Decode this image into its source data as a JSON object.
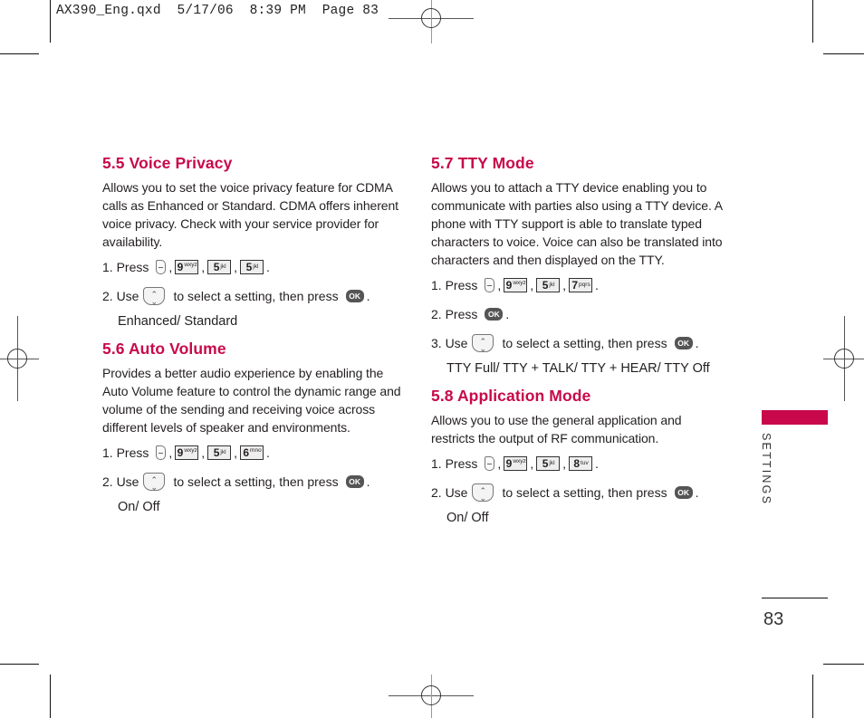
{
  "slug": "AX390_Eng.qxd  5/17/06  8:39 PM  Page 83",
  "sections": [
    {
      "title": "5.5 Voice Privacy",
      "body": "Allows you to set the voice privacy feature for CDMA calls as Enhanced or Standard. CDMA offers inherent voice privacy. Check with your service provider for availability.",
      "step1": {
        "prefix": "1. Press",
        "keys": [
          {
            "num": "9",
            "letters": "wxyz"
          },
          {
            "num": "5",
            "letters": "jkl"
          },
          {
            "num": "5",
            "letters": "jkl"
          }
        ]
      },
      "step2": {
        "prefix": "2. Use",
        "middle": "to select a setting, then press",
        "ok": "OK"
      },
      "options": "Enhanced/ Standard"
    },
    {
      "title": "5.6 Auto Volume",
      "body": "Provides a better audio experience by enabling the Auto Volume feature to control the dynamic range and volume of the sending and receiving voice across different levels of speaker and environments.",
      "step1": {
        "prefix": "1. Press",
        "keys": [
          {
            "num": "9",
            "letters": "wxyz"
          },
          {
            "num": "5",
            "letters": "jkl"
          },
          {
            "num": "6",
            "letters": "mno"
          }
        ]
      },
      "step2": {
        "prefix": "2. Use",
        "middle": "to select a setting, then press",
        "ok": "OK"
      },
      "options": "On/ Off"
    },
    {
      "title": "5.7 TTY Mode",
      "body": "Allows you to attach a TTY device enabling you to communicate with parties also using a TTY device. A phone with TTY support is able to translate typed characters to voice. Voice can also be translated into characters and then displayed on the TTY.",
      "step1": {
        "prefix": "1. Press",
        "keys": [
          {
            "num": "9",
            "letters": "wxyz"
          },
          {
            "num": "5",
            "letters": "jkl"
          },
          {
            "num": "7",
            "letters": "pqrs"
          }
        ]
      },
      "step2": {
        "prefix": "2. Press",
        "ok": "OK"
      },
      "step3": {
        "prefix": "3. Use",
        "middle": "to select a setting, then press",
        "ok": "OK"
      },
      "options": "TTY Full/ TTY + TALK/ TTY + HEAR/ TTY Off"
    },
    {
      "title": "5.8 Application Mode",
      "body": "Allows you to use the general application and restricts the output of RF communication.",
      "step1": {
        "prefix": "1. Press",
        "keys": [
          {
            "num": "9",
            "letters": "wxyz"
          },
          {
            "num": "5",
            "letters": "jkl"
          },
          {
            "num": "8",
            "letters": "tuv"
          }
        ]
      },
      "step2": {
        "prefix": "2. Use",
        "middle": "to select a setting, then press",
        "ok": "OK"
      },
      "options": "On/ Off"
    }
  ],
  "side_tab": {
    "label": "SETTINGS",
    "color": "#c8084a"
  },
  "page_number": "83",
  "accent_color": "#c8084a",
  "punct": {
    "comma": ",",
    "period": "."
  }
}
